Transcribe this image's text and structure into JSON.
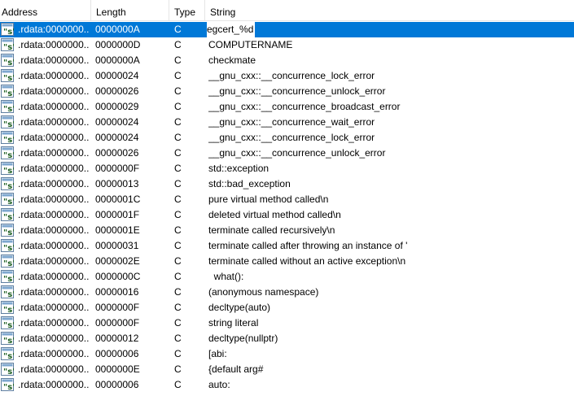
{
  "columns": {
    "address": "Address",
    "length": "Length",
    "type": "Type",
    "string": "String"
  },
  "icon": "string-literal-icon",
  "selected_row": 0,
  "rows": [
    {
      "address": ".rdata:0000000...",
      "length": "0000000A",
      "type": "C",
      "string": "egcert_%d"
    },
    {
      "address": ".rdata:0000000...",
      "length": "0000000D",
      "type": "C",
      "string": "COMPUTERNAME"
    },
    {
      "address": ".rdata:0000000...",
      "length": "0000000A",
      "type": "C",
      "string": "checkmate"
    },
    {
      "address": ".rdata:0000000...",
      "length": "00000024",
      "type": "C",
      "string": "__gnu_cxx::__concurrence_lock_error"
    },
    {
      "address": ".rdata:0000000...",
      "length": "00000026",
      "type": "C",
      "string": "__gnu_cxx::__concurrence_unlock_error"
    },
    {
      "address": ".rdata:0000000...",
      "length": "00000029",
      "type": "C",
      "string": "__gnu_cxx::__concurrence_broadcast_error"
    },
    {
      "address": ".rdata:0000000...",
      "length": "00000024",
      "type": "C",
      "string": "__gnu_cxx::__concurrence_wait_error"
    },
    {
      "address": ".rdata:0000000...",
      "length": "00000024",
      "type": "C",
      "string": "__gnu_cxx::__concurrence_lock_error"
    },
    {
      "address": ".rdata:0000000...",
      "length": "00000026",
      "type": "C",
      "string": "__gnu_cxx::__concurrence_unlock_error"
    },
    {
      "address": ".rdata:0000000...",
      "length": "0000000F",
      "type": "C",
      "string": "std::exception"
    },
    {
      "address": ".rdata:0000000...",
      "length": "00000013",
      "type": "C",
      "string": "std::bad_exception"
    },
    {
      "address": ".rdata:0000000...",
      "length": "0000001C",
      "type": "C",
      "string": "pure virtual method called\\n"
    },
    {
      "address": ".rdata:0000000...",
      "length": "0000001F",
      "type": "C",
      "string": "deleted virtual method called\\n"
    },
    {
      "address": ".rdata:0000000...",
      "length": "0000001E",
      "type": "C",
      "string": "terminate called recursively\\n"
    },
    {
      "address": ".rdata:0000000...",
      "length": "00000031",
      "type": "C",
      "string": "terminate called after throwing an instance of '"
    },
    {
      "address": ".rdata:0000000...",
      "length": "0000002E",
      "type": "C",
      "string": "terminate called without an active exception\\n"
    },
    {
      "address": ".rdata:0000000...",
      "length": "0000000C",
      "type": "C",
      "string": "  what():"
    },
    {
      "address": ".rdata:0000000...",
      "length": "00000016",
      "type": "C",
      "string": "(anonymous namespace)"
    },
    {
      "address": ".rdata:0000000...",
      "length": "0000000F",
      "type": "C",
      "string": "decltype(auto)"
    },
    {
      "address": ".rdata:0000000...",
      "length": "0000000F",
      "type": "C",
      "string": "string literal"
    },
    {
      "address": ".rdata:0000000...",
      "length": "00000012",
      "type": "C",
      "string": "decltype(nullptr)"
    },
    {
      "address": ".rdata:0000000...",
      "length": "00000006",
      "type": "C",
      "string": "[abi:"
    },
    {
      "address": ".rdata:0000000...",
      "length": "0000000E",
      "type": "C",
      "string": "{default arg#"
    },
    {
      "address": ".rdata:0000000...",
      "length": "00000006",
      "type": "C",
      "string": "auto:"
    }
  ]
}
